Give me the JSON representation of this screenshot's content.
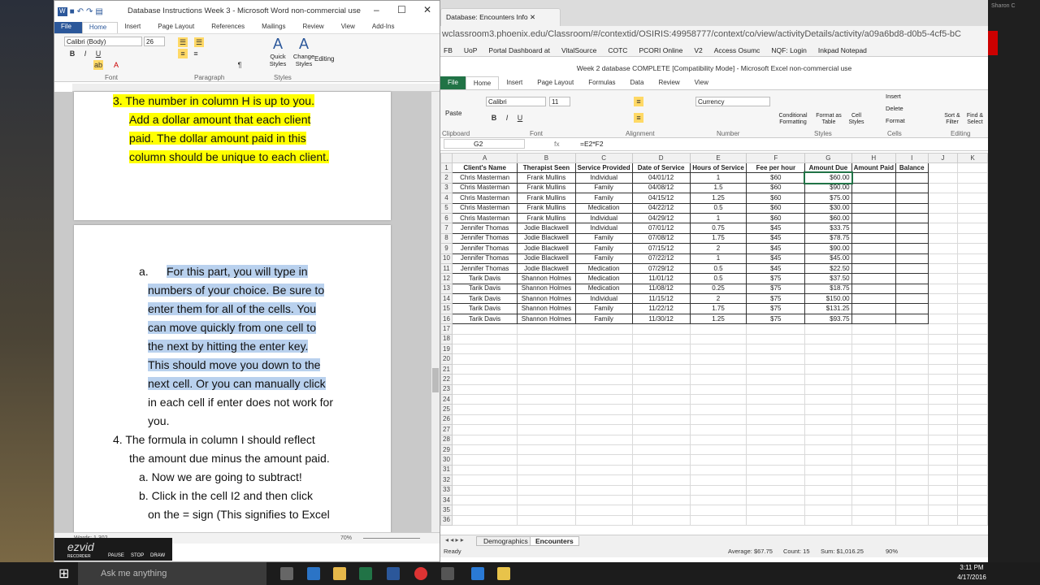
{
  "word": {
    "title": "Database Instructions  Week 3  -  Microsoft Word non-commercial use",
    "tabs": [
      "File",
      "Home",
      "Insert",
      "Page Layout",
      "References",
      "Mailings",
      "Review",
      "View",
      "Add-Ins"
    ],
    "font_name": "Calibri (Body)",
    "font_size": "26",
    "groups": {
      "font": "Font",
      "paragraph": "Paragraph",
      "styles": "Styles"
    },
    "quick_styles": "Quick Styles",
    "change_styles": "Change Styles",
    "editing": "Editing",
    "page1_lines": [
      "3.  The number in column H is up to you.",
      "Add a dollar amount that each client",
      "paid. The dollar amount paid in this",
      "column should be unique to each client."
    ],
    "page2_a_label": "a.",
    "page2_sel_lines": [
      "For this part, you will type in",
      "numbers of your choice. Be sure to",
      "enter them for all of the cells.  You",
      "can move quickly from one cell to",
      "the next by hitting the enter key.",
      "This should move you down to the",
      "next cell.  Or you can manually click"
    ],
    "page2_plain_lines": [
      "in each cell if enter does not work for",
      "you."
    ],
    "item4": [
      "4.  The formula in column I should reflect",
      "the amount due minus the amount paid."
    ],
    "item4a": "a.      Now we are going to subtract!",
    "item4b": [
      "b.      Click in the cell I2 and then click",
      "on the = sign   (This signifies to Excel"
    ],
    "status_words": "Words: 1,302",
    "zoom": "70%"
  },
  "ezvid": {
    "brand": "ezvid",
    "sub": "RECORDER",
    "buttons": [
      "PAUSE",
      "STOP",
      "DRAW"
    ]
  },
  "browser": {
    "tab": "Database: Encounters Info",
    "url": "wclassroom3.phoenix.edu/Classroom/#/contextid/OSIRIS:49958777/context/co/view/activityDetails/activity/a09a6bd8-d0b5-4cf5-bC",
    "bookmarks": [
      "FB",
      "UoP",
      "Portal Dashboard at",
      "VitalSource",
      "COTC",
      "PCORI Online",
      "V2",
      "Access Osumc",
      "NQF: Login",
      "Inkpad Notepad"
    ],
    "user": "Sharon C"
  },
  "excel": {
    "title": "Week 2 database COMPLETE  [Compatibility Mode]  -  Microsoft Excel non-commercial use",
    "tabs": [
      "File",
      "Home",
      "Insert",
      "Page Layout",
      "Formulas",
      "Data",
      "Review",
      "View"
    ],
    "font_name": "Calibri",
    "font_size": "11",
    "number_format": "Currency",
    "groups": [
      "Clipboard",
      "Font",
      "Alignment",
      "Number",
      "Styles",
      "Cells",
      "Editing"
    ],
    "ribbon_buttons": [
      "Paste",
      "Conditional Formatting",
      "Format as Table",
      "Cell Styles",
      "Insert",
      "Delete",
      "Format",
      "Sort & Filter",
      "Find & Select"
    ],
    "name_box": "G2",
    "formula": "=E2*F2",
    "col_letters": [
      "A",
      "B",
      "C",
      "D",
      "E",
      "F",
      "G",
      "H",
      "I",
      "J",
      "K"
    ],
    "headers": [
      "Client's Name",
      "Therapist Seen",
      "Service Provided",
      "Date of Service",
      "Hours of Service",
      "Fee per hour",
      "Amount Due",
      "Amount Paid",
      "Balance"
    ],
    "rows": [
      [
        "Chris Masterman",
        "Frank Mullins",
        "Individual",
        "04/01/12",
        "1",
        "$60",
        "$60.00"
      ],
      [
        "Chris Masterman",
        "Frank Mullins",
        "Family",
        "04/08/12",
        "1.5",
        "$60",
        "$90.00"
      ],
      [
        "Chris Masterman",
        "Frank Mullins",
        "Family",
        "04/15/12",
        "1.25",
        "$60",
        "$75.00"
      ],
      [
        "Chris Masterman",
        "Frank Mullins",
        "Medication",
        "04/22/12",
        "0.5",
        "$60",
        "$30.00"
      ],
      [
        "Chris Masterman",
        "Frank Mullins",
        "Individual",
        "04/29/12",
        "1",
        "$60",
        "$60.00"
      ],
      [
        "Jennifer Thomas",
        "Jodie Blackwell",
        "Individual",
        "07/01/12",
        "0.75",
        "$45",
        "$33.75"
      ],
      [
        "Jennifer Thomas",
        "Jodie Blackwell",
        "Family",
        "07/08/12",
        "1.75",
        "$45",
        "$78.75"
      ],
      [
        "Jennifer Thomas",
        "Jodie Blackwell",
        "Family",
        "07/15/12",
        "2",
        "$45",
        "$90.00"
      ],
      [
        "Jennifer Thomas",
        "Jodie Blackwell",
        "Family",
        "07/22/12",
        "1",
        "$45",
        "$45.00"
      ],
      [
        "Jennifer Thomas",
        "Jodie Blackwell",
        "Medication",
        "07/29/12",
        "0.5",
        "$45",
        "$22.50"
      ],
      [
        "Tarik Davis",
        "Shannon Holmes",
        "Medication",
        "11/01/12",
        "0.5",
        "$75",
        "$37.50"
      ],
      [
        "Tarik Davis",
        "Shannon Holmes",
        "Medication",
        "11/08/12",
        "0.25",
        "$75",
        "$18.75"
      ],
      [
        "Tarik Davis",
        "Shannon Holmes",
        "Individual",
        "11/15/12",
        "2",
        "$75",
        "$150.00"
      ],
      [
        "Tarik Davis",
        "Shannon Holmes",
        "Family",
        "11/22/12",
        "1.75",
        "$75",
        "$131.25"
      ],
      [
        "Tarik Davis",
        "Shannon Holmes",
        "Family",
        "11/30/12",
        "1.25",
        "$75",
        "$93.75"
      ]
    ],
    "empty_rows": 20,
    "sheets": [
      "Demographics",
      "Encounters"
    ],
    "status": {
      "ready": "Ready",
      "average": "Average: $67.75",
      "count": "Count: 15",
      "sum": "Sum: $1,016.25",
      "zoom": "90%"
    }
  },
  "taskbar": {
    "search": "Ask me anything",
    "time": "3:11 PM",
    "date": "4/17/2016"
  }
}
